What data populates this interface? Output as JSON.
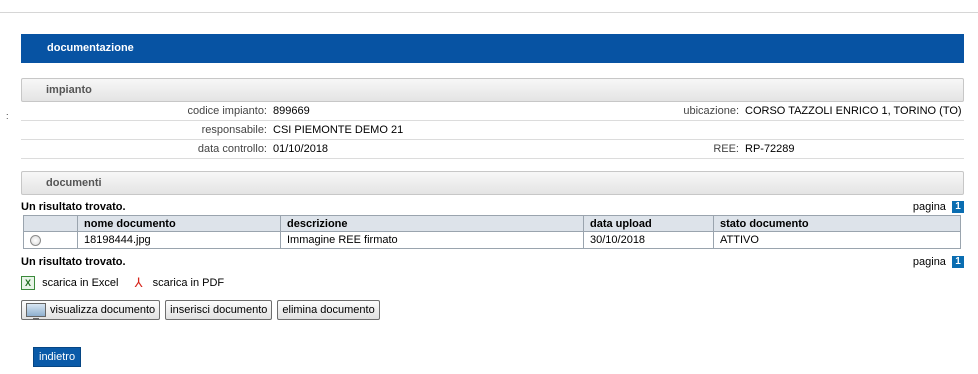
{
  "header": {
    "title": "documentazione"
  },
  "impianto": {
    "section_title": "impianto",
    "codice_label": "codice impianto:",
    "codice_value": "899669",
    "ubicazione_label": "ubicazione:",
    "ubicazione_value": "CORSO TAZZOLI ENRICO 1, TORINO (TO)",
    "responsabile_label": "responsabile:",
    "responsabile_value": "CSI PIEMONTE DEMO 21",
    "data_label": "data controllo:",
    "data_value": "01/10/2018",
    "ree_label": "REE:",
    "ree_value": "RP-72289"
  },
  "documenti": {
    "section_title": "documenti",
    "result_text": "Un risultato trovato.",
    "pager_label": "pagina",
    "pager_number": "1",
    "columns": [
      "nome documento",
      "descrizione",
      "data upload",
      "stato documento"
    ],
    "rows": [
      [
        "18198444.jpg",
        "Immagine REE firmato",
        "30/10/2018",
        "ATTIVO"
      ]
    ]
  },
  "export": {
    "excel_label": "scarica in Excel",
    "pdf_label": "scarica in PDF",
    "excel_icon_glyph": "X",
    "pdf_icon_glyph": "⅄"
  },
  "buttons": {
    "view": "visualizza documento",
    "insert": "inserisci documento",
    "delete": "elimina documento",
    "back": "indietro"
  },
  "colors": {
    "header_blue": "#0753a3",
    "pager_blue": "#0a6db1"
  }
}
